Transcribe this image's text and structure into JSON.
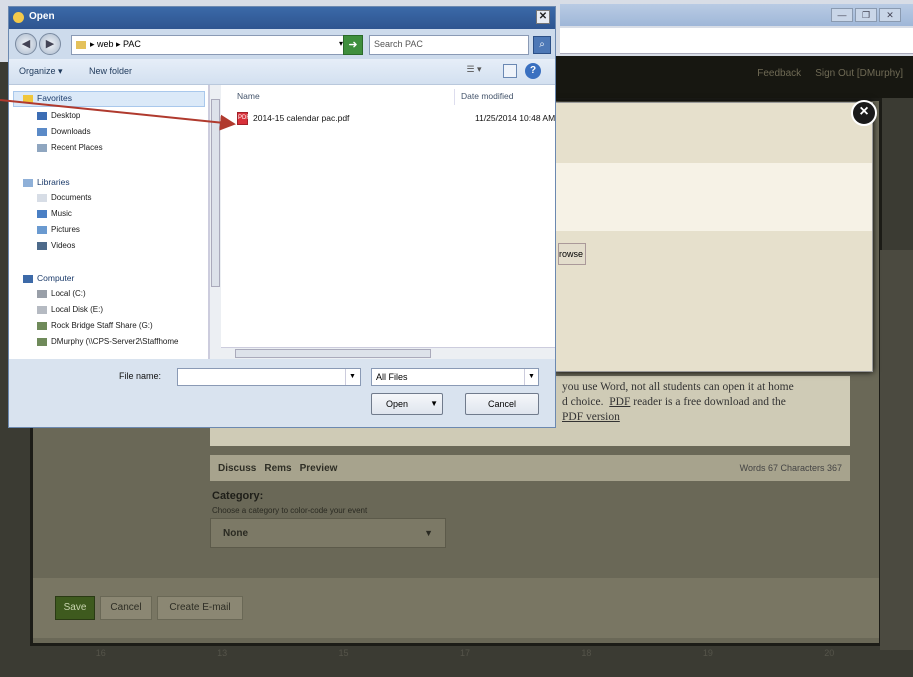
{
  "dialog": {
    "title": "Open",
    "close_glyph": "✕",
    "path": "▸ web ▸ PAC",
    "path_dropdown": "▾",
    "search_placeholder": "Search PAC",
    "organize_label": "Organize ▾",
    "new_folder_label": "New folder",
    "view_label": "☰ ▾",
    "nav": {
      "favorites": "Favorites",
      "desktop": "Desktop",
      "downloads": "Downloads",
      "recent_places": "Recent Places",
      "libraries": "Libraries",
      "documents": "Documents",
      "music": "Music",
      "pictures": "Pictures",
      "videos": "Videos",
      "computer": "Computer",
      "local_c": "Local (C:)",
      "local_disk_e": "Local Disk (E:)",
      "staff_share": "Rock Bridge Staff Share (G:)",
      "dmurphy": "DMurphy (\\\\CPS-Server2\\Staffhome"
    },
    "columns": {
      "name": "Name",
      "date_modified": "Date modified"
    },
    "files": [
      {
        "name": "2014-15 calendar pac.pdf",
        "date": "11/25/2014 10:48 AM",
        "icon": "pdf-icon"
      }
    ],
    "file_name_label": "File name:",
    "file_name_value": "",
    "file_type": "All Files",
    "open_label": "Open",
    "cancel_label": "Cancel"
  },
  "background": {
    "window_controls": [
      "—",
      "❐",
      "✕"
    ],
    "site_nav_links": [
      "Feedback",
      "Sign Out [DMurphy]"
    ],
    "modal_close": "×",
    "browse_label": "rowse",
    "info_text_1": "you use Word, not all students can open it at home",
    "info_text_2": "d choice.",
    "info_pdf_link": "PDF",
    "info_text_3": "reader is a free download and the",
    "info_pdf_version": "PDF version",
    "editor_toolbar": [
      "Discuss",
      "Rems",
      "Preview"
    ],
    "word_count": "Words 67 Characters 367",
    "category_label": "Category:",
    "category_hint": "Choose a category to color-code your event",
    "category_value": "None",
    "save_label": "Save",
    "cancel_label": "Cancel",
    "email_label": "Create E-mail",
    "calendar_days": [
      "16",
      "13",
      "15",
      "17",
      "18",
      "19",
      "20"
    ]
  },
  "colors": {
    "annotation_arrow": "#b03a2e",
    "save_button": "#3e5a1e"
  }
}
